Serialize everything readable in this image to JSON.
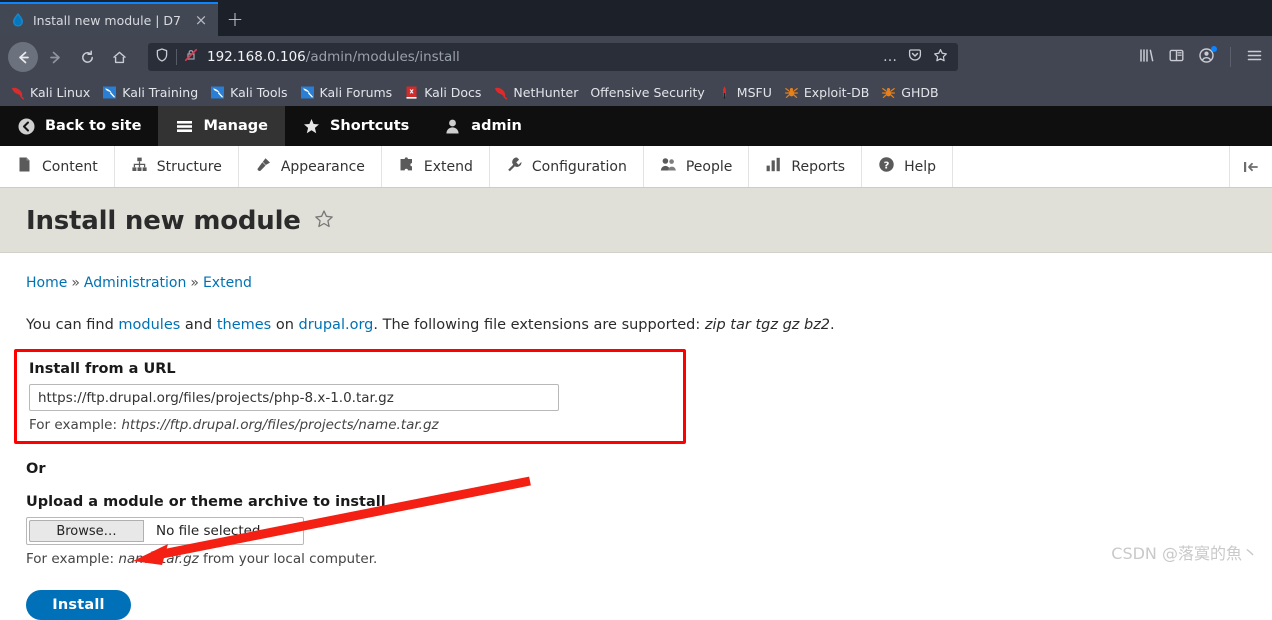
{
  "browser": {
    "tab": {
      "title": "Install new module | D7",
      "favicon": "drupal-drop-icon",
      "close": "×"
    },
    "new_tab_label": "+",
    "nav": {
      "back": "back-arrow-icon",
      "forward": "forward-arrow-icon",
      "reload": "reload-icon",
      "home": "home-icon"
    },
    "url": {
      "host": "192.168.0.106",
      "path": "/admin/modules/install",
      "shield": "tracking-protection-shield-icon",
      "insecure": "insecure-connection-icon",
      "page_actions": "…",
      "pocket": "pocket-icon",
      "bookmark_star": "star-outline-icon"
    },
    "right_icons": {
      "library": "library-icon",
      "sidebar": "sidebar-icon",
      "account": "account-icon",
      "menu": "hamburger-menu-icon"
    },
    "bookmarks": [
      {
        "label": "Kali Linux",
        "icon": "kali-dragon-red-icon"
      },
      {
        "label": "Kali Training",
        "icon": "kali-dragon-blue-icon"
      },
      {
        "label": "Kali Tools",
        "icon": "kali-dragon-blue-icon"
      },
      {
        "label": "Kali Forums",
        "icon": "kali-dragon-blue-icon"
      },
      {
        "label": "Kali Docs",
        "icon": "kali-docs-book-icon"
      },
      {
        "label": "NetHunter",
        "icon": "kali-dragon-red-icon"
      },
      {
        "label": "Offensive Security",
        "icon": ""
      },
      {
        "label": "MSFU",
        "icon": "metasploit-icon"
      },
      {
        "label": "Exploit-DB",
        "icon": "spider-icon"
      },
      {
        "label": "GHDB",
        "icon": "spider-icon"
      }
    ]
  },
  "admin_toolbar": {
    "items": [
      {
        "label": "Back to site",
        "icon": "back-circle-icon",
        "active": false
      },
      {
        "label": "Manage",
        "icon": "hamburger-icon",
        "active": true
      },
      {
        "label": "Shortcuts",
        "icon": "star-icon",
        "active": false
      },
      {
        "label": "admin",
        "icon": "user-icon",
        "active": false
      }
    ]
  },
  "admin_menu": {
    "items": [
      {
        "label": "Content",
        "icon": "file-icon"
      },
      {
        "label": "Structure",
        "icon": "structure-tree-icon"
      },
      {
        "label": "Appearance",
        "icon": "paintbrush-icon"
      },
      {
        "label": "Extend",
        "icon": "puzzle-piece-icon"
      },
      {
        "label": "Configuration",
        "icon": "wrench-icon"
      },
      {
        "label": "People",
        "icon": "people-icon"
      },
      {
        "label": "Reports",
        "icon": "bar-chart-icon"
      },
      {
        "label": "Help",
        "icon": "question-circle-icon"
      }
    ],
    "toggle_icon": "toolbar-orientation-toggle-icon"
  },
  "page": {
    "title": "Install new module",
    "shortcut_star": "star-outline-icon",
    "breadcrumb": [
      "Home",
      "Administration",
      "Extend"
    ],
    "breadcrumb_sep": "»",
    "intro": {
      "part1": "You can find ",
      "link_modules": "modules",
      "part2": " and ",
      "link_themes": "themes",
      "part3": " on ",
      "link_drupal": "drupal.org",
      "part4": ". The following file extensions are supported: ",
      "extensions": "zip tar tgz gz bz2",
      "part5": "."
    },
    "url_field": {
      "label": "Install from a URL",
      "value": "https://ftp.drupal.org/files/projects/php-8.x-1.0.tar.gz",
      "placeholder": "",
      "help_prefix": "For example: ",
      "help_example": "https://ftp.drupal.org/files/projects/name.tar.gz"
    },
    "or_label": "Or",
    "upload_field": {
      "label": "Upload a module or theme archive to install",
      "browse_label": "Browse…",
      "file_status": "No file selected.",
      "help_prefix": "For example: ",
      "help_example": "name.tar.gz",
      "help_suffix": " from your local computer."
    },
    "submit_label": "Install"
  },
  "annotations": {
    "highlight_color": "#ff0000",
    "arrow_color": "#ff2400",
    "watermark": "CSDN @落寞的魚丶"
  }
}
